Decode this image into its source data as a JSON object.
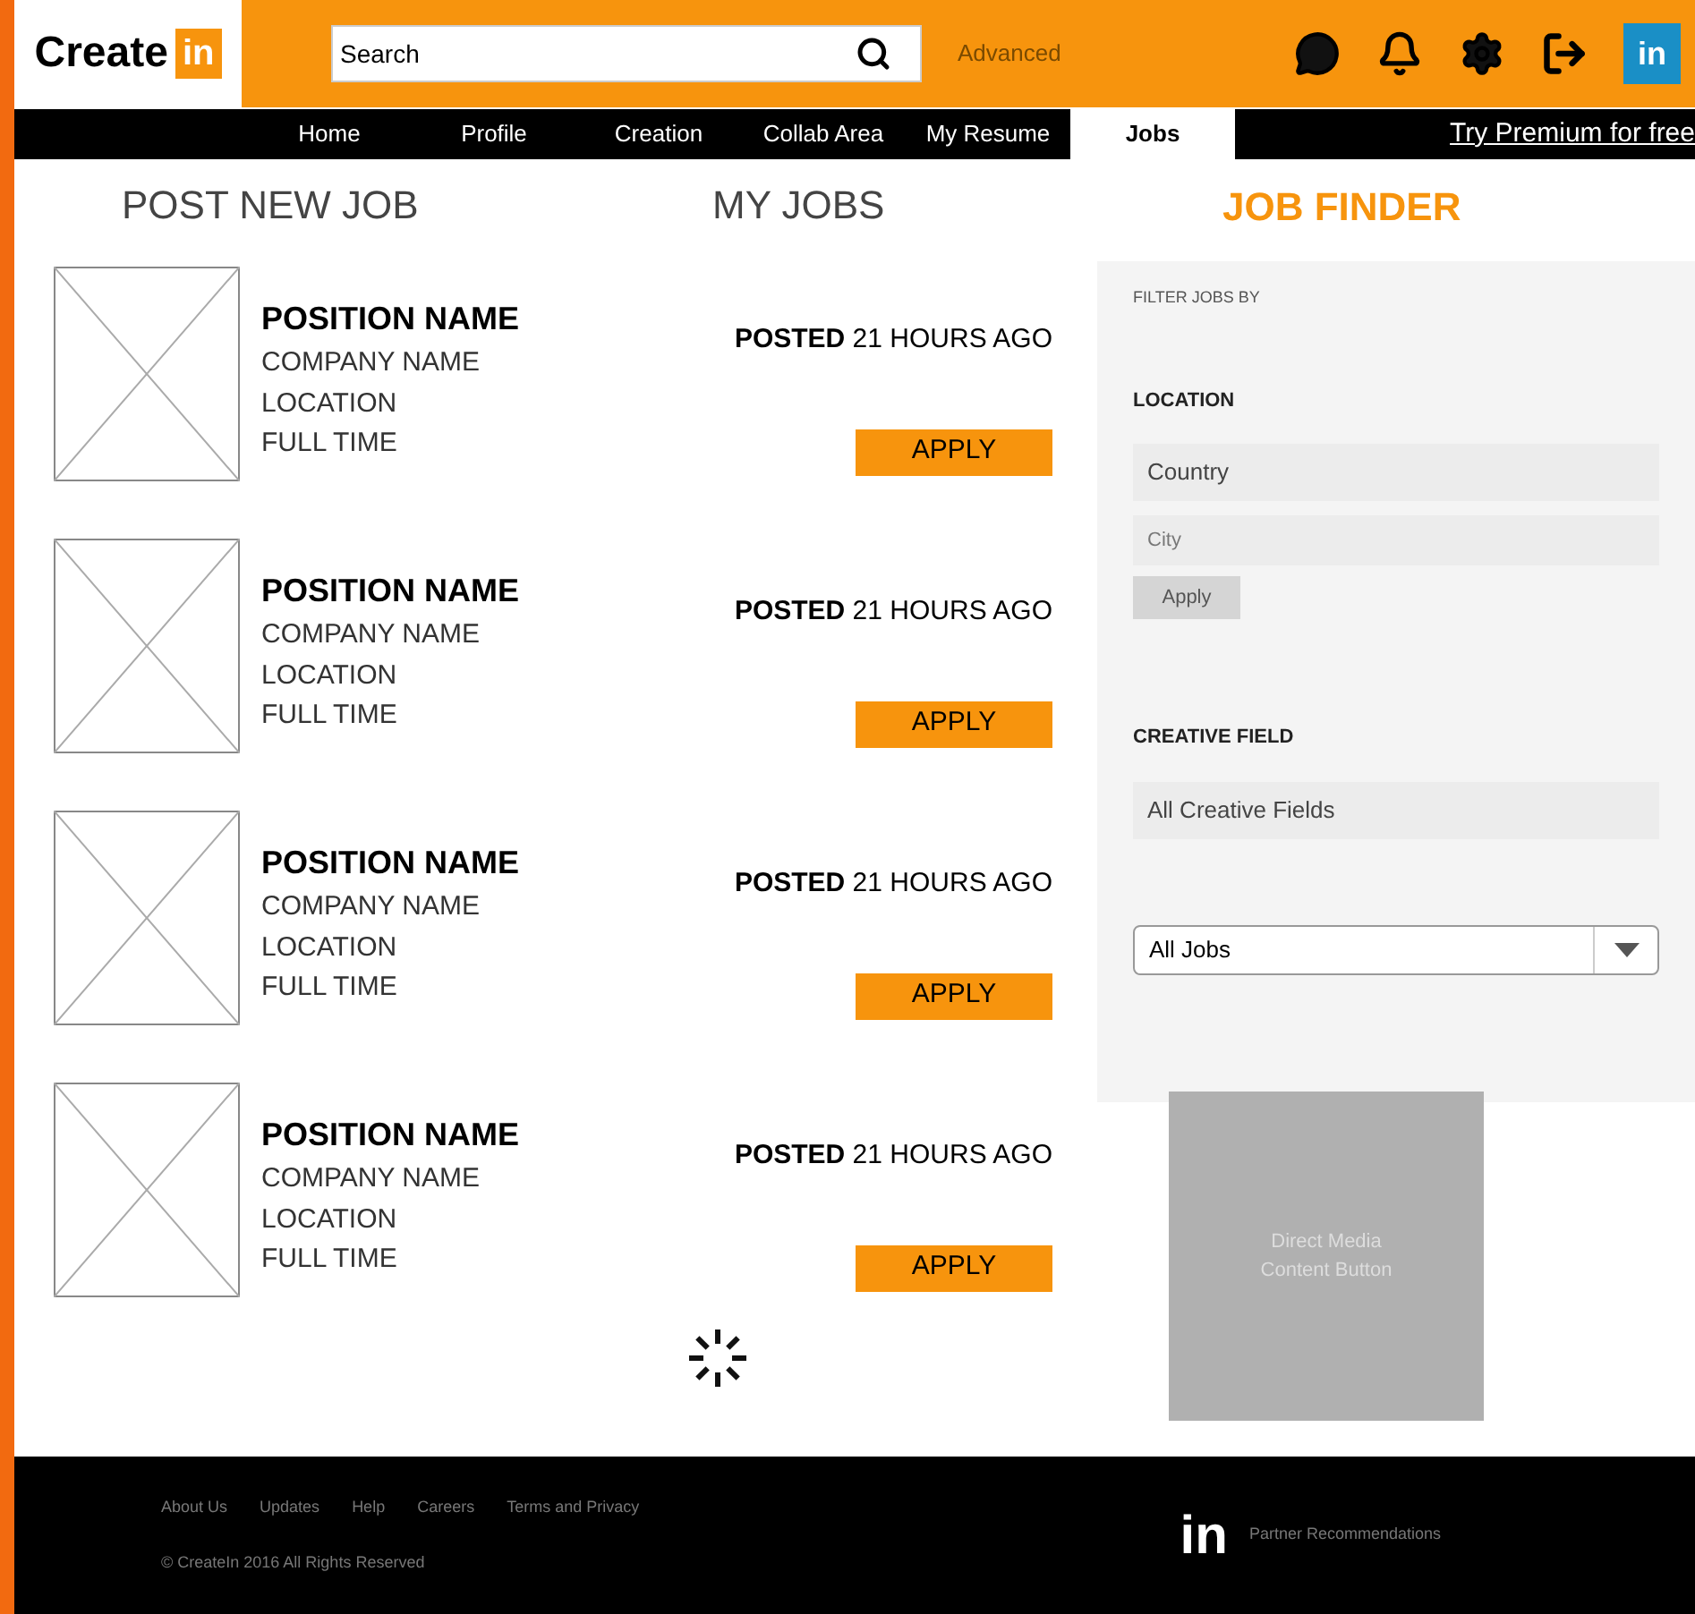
{
  "header": {
    "logo_text": "Create",
    "logo_badge": "in",
    "search": {
      "value": "Search"
    },
    "advanced": "Advanced",
    "profile_badge": "in"
  },
  "nav": {
    "tabs": [
      {
        "label": "Home",
        "selected": false
      },
      {
        "label": "Profile",
        "selected": false
      },
      {
        "label": "Creation",
        "selected": false
      },
      {
        "label": "Collab Area",
        "selected": false
      },
      {
        "label": "My Resume",
        "selected": false
      },
      {
        "label": "Jobs",
        "selected": true
      }
    ],
    "premium": "Try Premium for free"
  },
  "headings": {
    "post": "POST NEW JOB",
    "my_jobs": "MY JOBS",
    "finder": "JOB FINDER"
  },
  "jobs": [
    {
      "position": "POSITION NAME",
      "company": "COMPANY NAME",
      "location": "LOCATION",
      "type": "FULL TIME",
      "posted_prefix": "POSTED",
      "posted_rest": "21 HOURS AGO",
      "action": "APPLY"
    },
    {
      "position": "POSITION NAME",
      "company": "COMPANY NAME",
      "location": "LOCATION",
      "type": "FULL TIME",
      "posted_prefix": "POSTED",
      "posted_rest": "21 HOURS AGO",
      "action": "APPLY"
    },
    {
      "position": "POSITION NAME",
      "company": "COMPANY NAME",
      "location": "LOCATION",
      "type": "FULL TIME",
      "posted_prefix": "POSTED",
      "posted_rest": "21 HOURS AGO",
      "action": "APPLY"
    },
    {
      "position": "POSITION NAME",
      "company": "COMPANY NAME",
      "location": "LOCATION",
      "type": "FULL TIME",
      "posted_prefix": "POSTED",
      "posted_rest": "21 HOURS AGO",
      "action": "APPLY"
    }
  ],
  "filter": {
    "title": "FILTER JOBS BY",
    "location_label": "LOCATION",
    "country": "Country",
    "city_placeholder": "City",
    "apply": "Apply",
    "creative_label": "CREATIVE FIELD",
    "creative": "All Creative Fields",
    "job_type": "All Jobs"
  },
  "ad": {
    "lines": [
      "Direct Media",
      "Content Button"
    ]
  },
  "footer": {
    "links": [
      "About Us",
      "Updates",
      "Help",
      "Careers",
      "Terms and Privacy"
    ],
    "copyright": "© CreateIn 2016 All Rights Reserved",
    "badge": "in",
    "partner": "Partner Recommendations"
  }
}
